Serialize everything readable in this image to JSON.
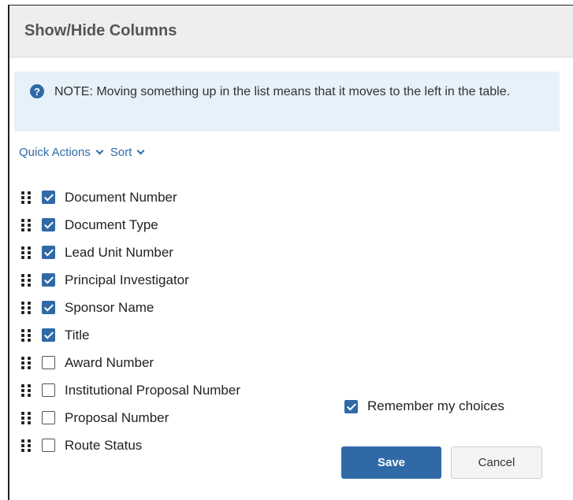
{
  "dialog": {
    "title": "Show/Hide Columns",
    "note": "NOTE: Moving something up in the list means that it moves to the left in the table.",
    "note_icon": "?",
    "quick_actions_label": "Quick Actions",
    "sort_label": "Sort",
    "columns": [
      {
        "label": "Document Number",
        "checked": true
      },
      {
        "label": "Document Type",
        "checked": true
      },
      {
        "label": "Lead Unit Number",
        "checked": true
      },
      {
        "label": "Principal Investigator",
        "checked": true
      },
      {
        "label": "Sponsor Name",
        "checked": true
      },
      {
        "label": "Title",
        "checked": true
      },
      {
        "label": "Award Number",
        "checked": false
      },
      {
        "label": "Institutional Proposal Number",
        "checked": false
      },
      {
        "label": "Proposal Number",
        "checked": false
      },
      {
        "label": "Route Status",
        "checked": false
      }
    ],
    "remember_label": "Remember my choices",
    "remember_checked": true,
    "save_label": "Save",
    "cancel_label": "Cancel"
  },
  "colors": {
    "accent": "#2f6aa7",
    "note_bg": "#e6f1f9",
    "header_bg": "#eeeeee"
  }
}
